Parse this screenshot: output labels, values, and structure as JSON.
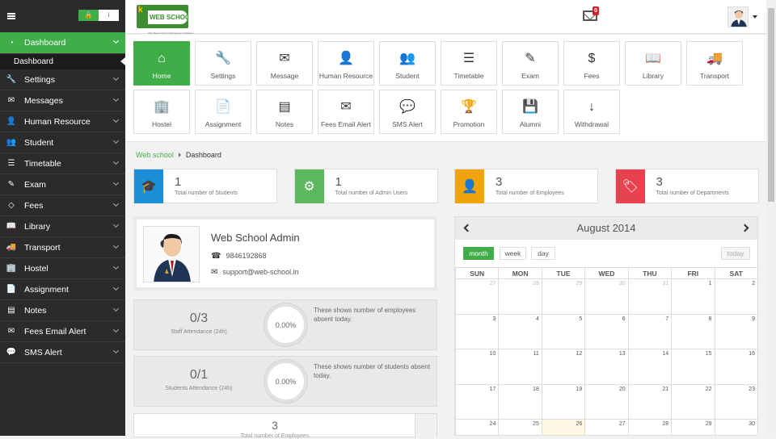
{
  "sidebar": {
    "lock_icon": "lock-icon",
    "info_icon": "info-icon",
    "items": [
      {
        "label": "Dashboard",
        "icon": "dashboard-icon",
        "active": true
      },
      {
        "label": "Settings",
        "icon": "wrench-icon"
      },
      {
        "label": "Messages",
        "icon": "envelope-icon"
      },
      {
        "label": "Human Resource",
        "icon": "user-icon"
      },
      {
        "label": "Student",
        "icon": "users-icon"
      },
      {
        "label": "Timetable",
        "icon": "list-icon"
      },
      {
        "label": "Exam",
        "icon": "edit-icon"
      },
      {
        "label": "Fees",
        "icon": "tag-icon"
      },
      {
        "label": "Library",
        "icon": "book-icon"
      },
      {
        "label": "Transport",
        "icon": "truck-icon"
      },
      {
        "label": "Hostel",
        "icon": "building-icon"
      },
      {
        "label": "Assignment",
        "icon": "file-icon"
      },
      {
        "label": "Notes",
        "icon": "list-alt-icon"
      },
      {
        "label": "Fees Email Alert",
        "icon": "envelope-icon"
      },
      {
        "label": "SMS Alert",
        "icon": "comment-icon"
      }
    ],
    "sub_item": "Dashboard"
  },
  "header": {
    "logo_text": "WEB SCHOOL",
    "logo_tag": "Web Based School Management Software",
    "mail_count": "0"
  },
  "tiles": [
    {
      "label": "Home",
      "icon": "⌂",
      "active": true
    },
    {
      "label": "Settings",
      "icon": "🔧"
    },
    {
      "label": "Message",
      "icon": "✉"
    },
    {
      "label": "Human Resource",
      "icon": "👤"
    },
    {
      "label": "Student",
      "icon": "👥"
    },
    {
      "label": "Timetable",
      "icon": "☰"
    },
    {
      "label": "Exam",
      "icon": "✎"
    },
    {
      "label": "Fees",
      "icon": "$"
    },
    {
      "label": "Library",
      "icon": "📖"
    },
    {
      "label": "Transport",
      "icon": "🚚"
    },
    {
      "label": "Hostel",
      "icon": "🏢"
    },
    {
      "label": "Assignment",
      "icon": "📄"
    },
    {
      "label": "Notes",
      "icon": "▤"
    },
    {
      "label": "Fees Email Alert",
      "icon": "✉"
    },
    {
      "label": "SMS Alert",
      "icon": "💬"
    },
    {
      "label": "Promotion",
      "icon": "🏆"
    },
    {
      "label": "Alumni",
      "icon": "💾"
    },
    {
      "label": "Withdrawal",
      "icon": "↓"
    }
  ],
  "breadcrumb": {
    "root": "Web school",
    "current": "Dashboard"
  },
  "stats": [
    {
      "value": "1",
      "label": "Total number of Students",
      "color": "#1a8fd8",
      "icon": "🎓"
    },
    {
      "value": "1",
      "label": "Total number of Admin Users",
      "color": "#5cb85c",
      "icon": "⚙"
    },
    {
      "value": "3",
      "label": "Total number of Employees",
      "color": "#f0a30a",
      "icon": "👤"
    },
    {
      "value": "3",
      "label": "Total number of Departments",
      "color": "#e8424f",
      "icon": "🏷"
    }
  ],
  "profile": {
    "name": "Web School Admin",
    "phone": "9846192868",
    "email": "support@web-school.in"
  },
  "attendance": [
    {
      "value": "0/3",
      "label": "Staff Attendance (24h)",
      "percent": "0.00%",
      "desc": "These shows number of employees absent today."
    },
    {
      "value": "0/1",
      "label": "Students Attendance (24h)",
      "percent": "0.00%",
      "desc": "These shows number of students absent today."
    },
    {
      "value": "3",
      "label": "Total number of Employees"
    }
  ],
  "calendar": {
    "title": "August 2014",
    "views": [
      "month",
      "week",
      "day"
    ],
    "today_label": "today",
    "days": [
      "SUN",
      "MON",
      "TUE",
      "WED",
      "THU",
      "FRI",
      "SAT"
    ],
    "weeks": [
      [
        "27",
        "28",
        "29",
        "30",
        "31",
        "1",
        "2"
      ],
      [
        "3",
        "4",
        "5",
        "6",
        "7",
        "8",
        "9"
      ],
      [
        "10",
        "11",
        "12",
        "13",
        "14",
        "15",
        "16"
      ],
      [
        "17",
        "18",
        "19",
        "20",
        "21",
        "22",
        "23"
      ],
      [
        "24",
        "25",
        "26",
        "27",
        "28",
        "29",
        "30"
      ]
    ],
    "today": "26"
  }
}
